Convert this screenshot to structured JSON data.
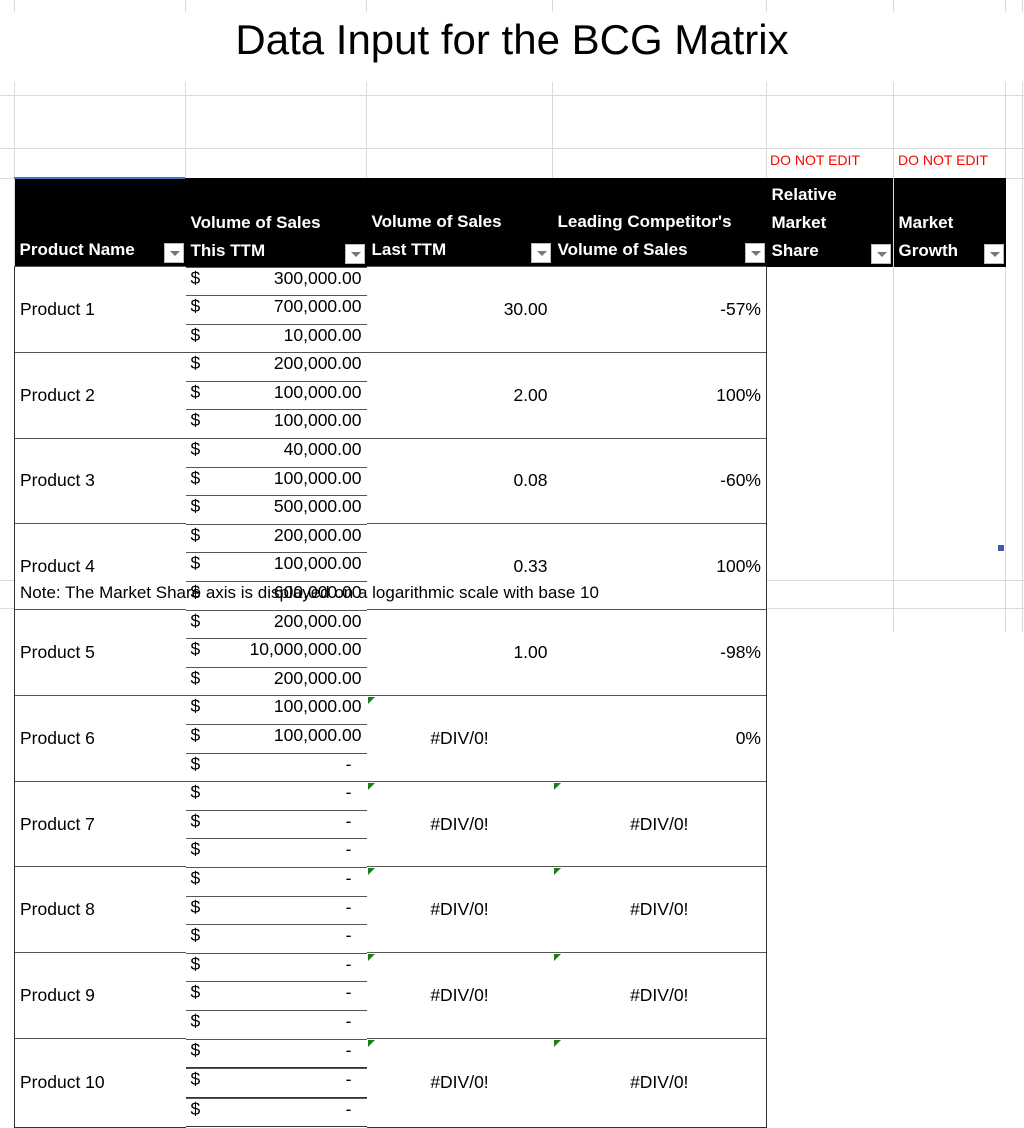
{
  "title": "Data Input for the BCG Matrix",
  "warnings": [
    "DO NOT EDIT",
    "DO NOT EDIT"
  ],
  "table": {
    "headers": [
      "Product Name",
      "Volume of Sales This TTM",
      "Volume of Sales Last TTM",
      "Leading Competitor's Volume of Sales",
      "Relative Market Share",
      "Market Growth"
    ],
    "currency_symbol": "$",
    "rows": [
      {
        "name": "Product 1",
        "this_ttm": "300,000.00",
        "last_ttm": "700,000.00",
        "competitor": "10,000.00",
        "rel_share": "30.00",
        "growth": "-57%"
      },
      {
        "name": "Product 2",
        "this_ttm": "200,000.00",
        "last_ttm": "100,000.00",
        "competitor": "100,000.00",
        "rel_share": "2.00",
        "growth": "100%"
      },
      {
        "name": "Product 3",
        "this_ttm": "40,000.00",
        "last_ttm": "100,000.00",
        "competitor": "500,000.00",
        "rel_share": "0.08",
        "growth": "-60%"
      },
      {
        "name": "Product 4",
        "this_ttm": "200,000.00",
        "last_ttm": "100,000.00",
        "competitor": "600,000.00",
        "rel_share": "0.33",
        "growth": "100%"
      },
      {
        "name": "Product 5",
        "this_ttm": "200,000.00",
        "last_ttm": "10,000,000.00",
        "competitor": "200,000.00",
        "rel_share": "1.00",
        "growth": "-98%"
      },
      {
        "name": "Product 6",
        "this_ttm": "100,000.00",
        "last_ttm": "100,000.00",
        "competitor": "-",
        "rel_share": "#DIV/0!",
        "growth": "0%"
      },
      {
        "name": "Product 7",
        "this_ttm": "-",
        "last_ttm": "-",
        "competitor": "-",
        "rel_share": "#DIV/0!",
        "growth": "#DIV/0!"
      },
      {
        "name": "Product 8",
        "this_ttm": "-",
        "last_ttm": "-",
        "competitor": "-",
        "rel_share": "#DIV/0!",
        "growth": "#DIV/0!"
      },
      {
        "name": "Product 9",
        "this_ttm": "-",
        "last_ttm": "-",
        "competitor": "-",
        "rel_share": "#DIV/0!",
        "growth": "#DIV/0!"
      },
      {
        "name": "Product 10",
        "this_ttm": "-",
        "last_ttm": "-",
        "competitor": "-",
        "rel_share": "#DIV/0!",
        "growth": "#DIV/0!"
      }
    ]
  },
  "note": "Note: The Market Share axis is displayed on a logarithmic scale with base 10",
  "colors": {
    "header_bg": "#000000",
    "warning": "#ff0000",
    "error_flag": "#1a7f1a",
    "selection": "#4472c4"
  }
}
